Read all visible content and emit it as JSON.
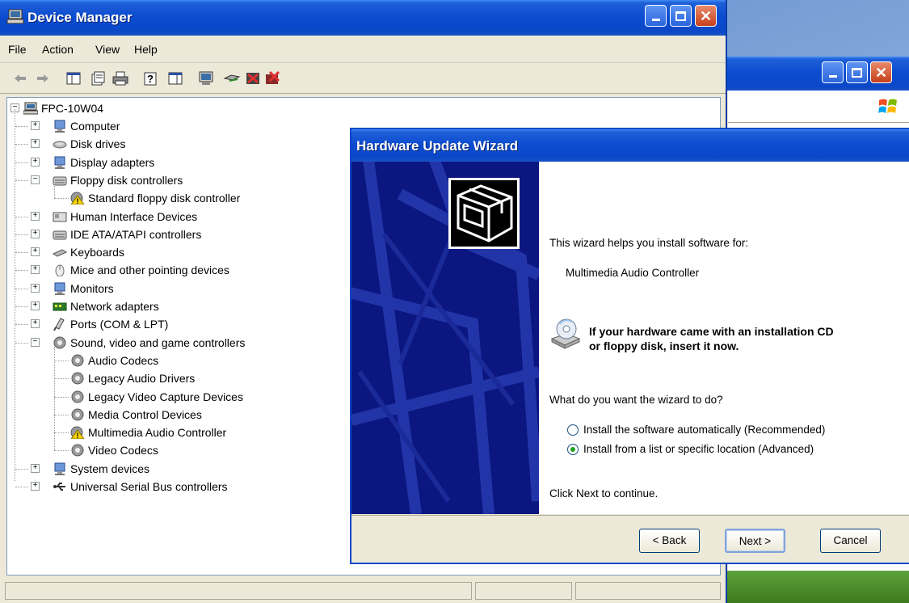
{
  "device_manager": {
    "title": "Device Manager",
    "menu": [
      "File",
      "Action",
      "View",
      "Help"
    ],
    "tree": {
      "root": "FPC-10W04",
      "items": [
        {
          "label": "Computer",
          "icon": "computer-icon",
          "expanded": false
        },
        {
          "label": "Disk drives",
          "icon": "disk-drive-icon",
          "expanded": false
        },
        {
          "label": "Display adapters",
          "icon": "display-adapter-icon",
          "expanded": false
        },
        {
          "label": "Floppy disk controllers",
          "icon": "floppy-controller-icon",
          "expanded": true
        },
        {
          "label": "Standard floppy disk controller",
          "icon": "warning-device-icon",
          "child": true
        },
        {
          "label": "Human Interface Devices",
          "icon": "hid-icon",
          "expanded": false
        },
        {
          "label": "IDE ATA/ATAPI controllers",
          "icon": "ide-controller-icon",
          "expanded": false
        },
        {
          "label": "Keyboards",
          "icon": "keyboard-icon",
          "expanded": false
        },
        {
          "label": "Mice and other pointing devices",
          "icon": "mouse-icon",
          "expanded": false
        },
        {
          "label": "Monitors",
          "icon": "monitor-icon",
          "expanded": false
        },
        {
          "label": "Network adapters",
          "icon": "network-adapter-icon",
          "expanded": false
        },
        {
          "label": "Ports (COM & LPT)",
          "icon": "port-icon",
          "expanded": false
        },
        {
          "label": "Sound, video and game controllers",
          "icon": "sound-icon",
          "expanded": true
        },
        {
          "label": "Audio Codecs",
          "icon": "sound-icon",
          "child": true
        },
        {
          "label": "Legacy Audio Drivers",
          "icon": "sound-icon",
          "child": true
        },
        {
          "label": "Legacy Video Capture Devices",
          "icon": "sound-icon",
          "child": true
        },
        {
          "label": "Media Control Devices",
          "icon": "sound-icon",
          "child": true
        },
        {
          "label": "Multimedia Audio Controller",
          "icon": "warning-device-icon",
          "child": true
        },
        {
          "label": "Video Codecs",
          "icon": "sound-icon",
          "child": true
        },
        {
          "label": "System devices",
          "icon": "system-device-icon",
          "expanded": false
        },
        {
          "label": "Universal Serial Bus controllers",
          "icon": "usb-icon",
          "expanded": false
        }
      ]
    }
  },
  "wizard": {
    "title": "Hardware Update Wizard",
    "intro": "This wizard helps you install software for:",
    "device": "Multimedia Audio Controller",
    "cd_line1": "If your hardware came with an installation CD",
    "cd_line2": "or floppy disk, insert it now.",
    "question": "What do you want the wizard to do?",
    "options": [
      {
        "label": "Install the software automatically (Recommended)",
        "selected": false
      },
      {
        "label": "Install from a list or specific location (Advanced)",
        "selected": true
      }
    ],
    "continue_text": "Click Next to continue.",
    "buttons": {
      "back": "< Back",
      "next": "Next >",
      "cancel": "Cancel"
    }
  },
  "colors": {
    "title_bar": "#0a48c7",
    "window_bg": "#ece9d8",
    "wizard_side": "#0c1680"
  }
}
